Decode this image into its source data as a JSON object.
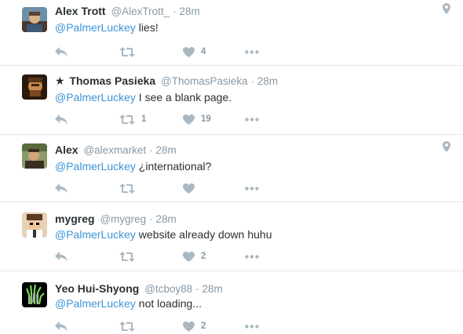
{
  "tweets": [
    {
      "name": "Alex Trott",
      "star": "",
      "handle": "@AlexTrott_",
      "dot": "·",
      "time": "28m",
      "mention": "@PalmerLuckey",
      "text": " lies!",
      "retweets": "",
      "likes": "4",
      "has_geo": true,
      "avatar_colors": [
        "#8a6b4d",
        "#d9b38c",
        "#3e5a78"
      ]
    },
    {
      "name": "Thomas Pasieka",
      "star": "★",
      "handle": "@ThomasPasieka",
      "dot": "·",
      "time": "28m",
      "mention": "@PalmerLuckey",
      "text": " I see a blank page.",
      "retweets": "1",
      "likes": "19",
      "has_geo": false,
      "avatar_colors": [
        "#7a4a1f",
        "#c98b4d",
        "#2a1a0e"
      ]
    },
    {
      "name": "Alex",
      "star": "",
      "handle": "@alexmarket",
      "dot": "·",
      "time": "28m",
      "mention": "@PalmerLuckey",
      "text": " ¿international?",
      "retweets": "",
      "likes": "",
      "has_geo": true,
      "avatar_colors": [
        "#5a6b3c",
        "#d2a57a",
        "#3b2f24"
      ]
    },
    {
      "name": "mygreg",
      "star": "",
      "handle": "@mygreg",
      "dot": "·",
      "time": "28m",
      "mention": "@PalmerLuckey",
      "text": " website already down huhu",
      "retweets": "",
      "likes": "2",
      "has_geo": false,
      "avatar_colors": [
        "#5b3a22",
        "#e6d2b8",
        "#ffffff"
      ]
    },
    {
      "name": "Yeo Hui-Shyong",
      "star": "",
      "handle": "@tcboy88",
      "dot": "·",
      "time": "28m",
      "mention": "@PalmerLuckey",
      "text": " not loading...",
      "retweets": "",
      "likes": "2",
      "has_geo": false,
      "avatar_colors": [
        "#000000",
        "#7bd35a",
        "#c7a0e6"
      ]
    }
  ],
  "icons": {
    "reply": "reply-icon",
    "retweet": "retweet-icon",
    "like": "heart-icon",
    "more": "more-icon",
    "geo": "location-pin-icon"
  },
  "colors": {
    "mention": "#3b94d9",
    "meta": "#8899a6",
    "icon": "#aab8c2",
    "border": "#e1e8ed"
  }
}
